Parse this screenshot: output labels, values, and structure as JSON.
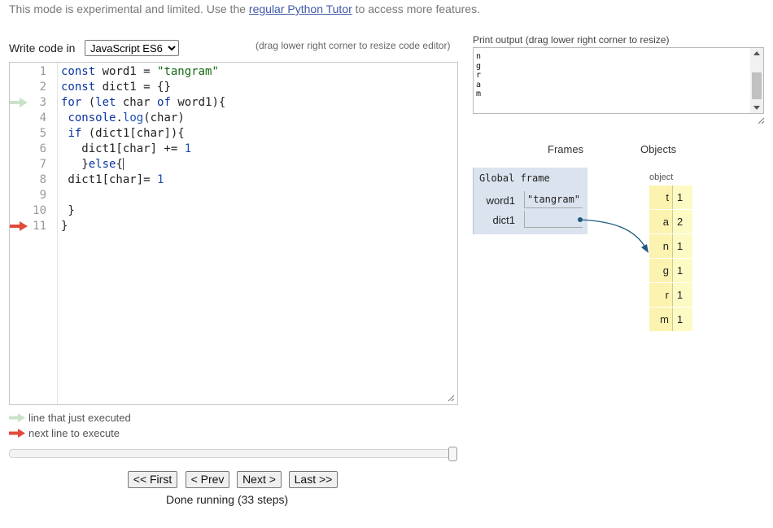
{
  "notice": {
    "before": "This mode is experimental and limited. Use the ",
    "link": "regular Python Tutor",
    "after": " to access more features."
  },
  "editor_header": {
    "label": "Write code in",
    "language": "JavaScript ES6",
    "drag_hint": "(drag lower right corner to resize code editor)"
  },
  "code_lines": [
    {
      "num": "1",
      "text": "const word1 = \"tangram\""
    },
    {
      "num": "2",
      "text": "const dict1 = {}"
    },
    {
      "num": "3",
      "text": "for (let char of word1){"
    },
    {
      "num": "4",
      "text": " console.log(char)"
    },
    {
      "num": "5",
      "text": " if (dict1[char]){"
    },
    {
      "num": "6",
      "text": "   dict1[char] += 1"
    },
    {
      "num": "7",
      "text": "   }else{"
    },
    {
      "num": "8",
      "text": " dict1[char]= 1"
    },
    {
      "num": "9",
      "text": ""
    },
    {
      "num": "10",
      "text": " }"
    },
    {
      "num": "11",
      "text": "}"
    }
  ],
  "arrows": {
    "just_executed_line": 3,
    "next_line": 11,
    "green_color": "#c8e3c8",
    "red_color": "#e04b3a"
  },
  "legend": {
    "just_executed": "line that just executed",
    "next_line": "next line to execute"
  },
  "navigation": {
    "first": "<< First",
    "prev": "< Prev",
    "next": "Next >",
    "last": "Last >>",
    "status": "Done running (33 steps)",
    "step_progress": 1.0
  },
  "output": {
    "label": "Print output (drag lower right corner to resize)",
    "lines": [
      "n",
      "g",
      "r",
      "a",
      "m"
    ]
  },
  "visualizer": {
    "frames_header": "Frames",
    "objects_header": "Objects",
    "global_frame_title": "Global frame",
    "variables": [
      {
        "name": "word1",
        "value": "\"tangram\""
      },
      {
        "name": "dict1",
        "value": ""
      }
    ],
    "object_type": "object",
    "dict_entries": [
      {
        "key": "t",
        "value": "1"
      },
      {
        "key": "a",
        "value": "2"
      },
      {
        "key": "n",
        "value": "1"
      },
      {
        "key": "g",
        "value": "1"
      },
      {
        "key": "r",
        "value": "1"
      },
      {
        "key": "m",
        "value": "1"
      }
    ],
    "pointer_color": "#1f5a7e"
  }
}
